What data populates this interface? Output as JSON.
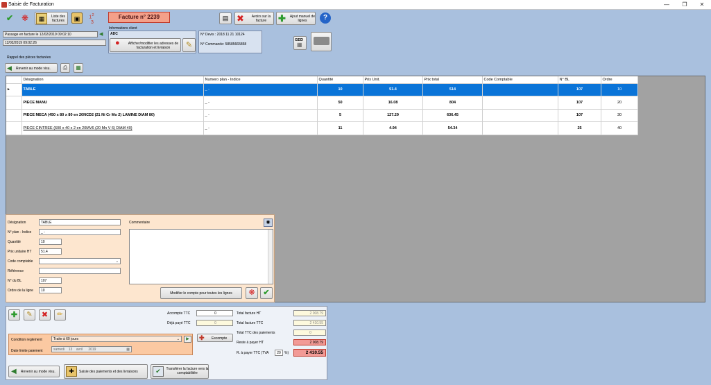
{
  "window": {
    "title": "Saisie de Facturation"
  },
  "toolbar": {
    "liste_factures": "Liste des factures",
    "facture_title": "Facture n° 2239",
    "avoirs": "Avoirs sur la facture",
    "ajout_manuel": "Ajout manuel de lignes",
    "ged": "GED"
  },
  "header": {
    "passage": "Passage en facture le 12/02/2019 09:02:10",
    "date2": "12/02/2019 09:02:26",
    "info_client_label": "Informations client",
    "client": "ADC",
    "adresses_btn": "Afficher/modifier les adresses de facturation et livraison",
    "devis": "N° Devis :  2018 11 21 10124",
    "commande": "N° Commande: 58585665858"
  },
  "rappel": {
    "label": "Rappel des pièces facturées",
    "revenir": "Revenir au mode visu."
  },
  "table": {
    "columns": [
      "Désignation",
      "Numero plan - Indice",
      "Quantité",
      "Prix Unit.",
      "Prix total",
      "Code Comptable",
      "N° BL",
      "Ordre"
    ],
    "rows": [
      {
        "designation": "TABLE",
        "plan": "_ -",
        "qte": "10",
        "pu": "51.4",
        "pt": "514",
        "code": "",
        "bl": "107",
        "ordre": "10"
      },
      {
        "designation": "PIECE MANU",
        "plan": "_ -",
        "qte": "50",
        "pu": "16.08",
        "pt": "804",
        "code": "",
        "bl": "107",
        "ordre": "20"
      },
      {
        "designation": "PIECE MECA (450 x 80 x 80  en 20NCD2 (21 Ni Cr Mo 2) LAMINE DIAM 80)",
        "plan": "_ -",
        "qte": "5",
        "pu": "127.29",
        "pt": "636.45",
        "code": "",
        "bl": "107",
        "ordre": "30"
      },
      {
        "designation": "PIECE CINTREE (600 x 40 x 2  en 20MV6 (20 Mn V 6) DIAM 40)",
        "plan": "_ -",
        "qte": "11",
        "pu": "4.94",
        "pt": "54.34",
        "code": "",
        "bl": "25",
        "ordre": "40"
      }
    ]
  },
  "edit": {
    "designation_label": "Désignation",
    "designation": "TABLE",
    "plan_label": "N° plan - Indice",
    "plan": "_ -",
    "qte_label": "Quantité",
    "qte": "10",
    "pu_label": "Prix unitaire HT",
    "pu": "51.4",
    "code_label": "Code comptable",
    "code": "",
    "ref_label": "Référence",
    "ref": "",
    "bl_label": "N° du BL",
    "bl": "107",
    "ordre_label": "Ordre de la ligne",
    "ordre": "10",
    "commentaire_label": "Commentaire",
    "modifier_btn": "Modifier le compte pour toutes les lignes"
  },
  "bottom": {
    "acompte_label": "Accompte TTC",
    "acompte": "0",
    "deja_paye_label": "Déjà payé TTC",
    "deja_paye": "0",
    "total_ht_label": "Total facture HT",
    "total_ht": "2 008.79",
    "total_ttc_label": "Total facture TTC",
    "total_ttc": "2 410.55",
    "total_paiements_label": "Total TTC des paiements",
    "total_paiements": "0",
    "reste_ht_label": "Reste à payer HT",
    "reste_ht": "2 008.79",
    "a_payer_label": "R. à payer TTC (TVA",
    "tva": "20",
    "pct": "%)",
    "a_payer": "2 410.55",
    "condition_label": "Condition reglement",
    "condition": "Traite à  60 jours",
    "escompte": "Escompte",
    "date_limite_label": "Date limite paiement",
    "date_day": "samedi",
    "date_num": "13",
    "date_month": "avril",
    "date_year": "2019",
    "revenir": "Revenir au mode visu.",
    "saisie_paiements": "Saisie des paiements et des livraisons",
    "transferer": "Transférer la facture vers la comptabilitée"
  }
}
